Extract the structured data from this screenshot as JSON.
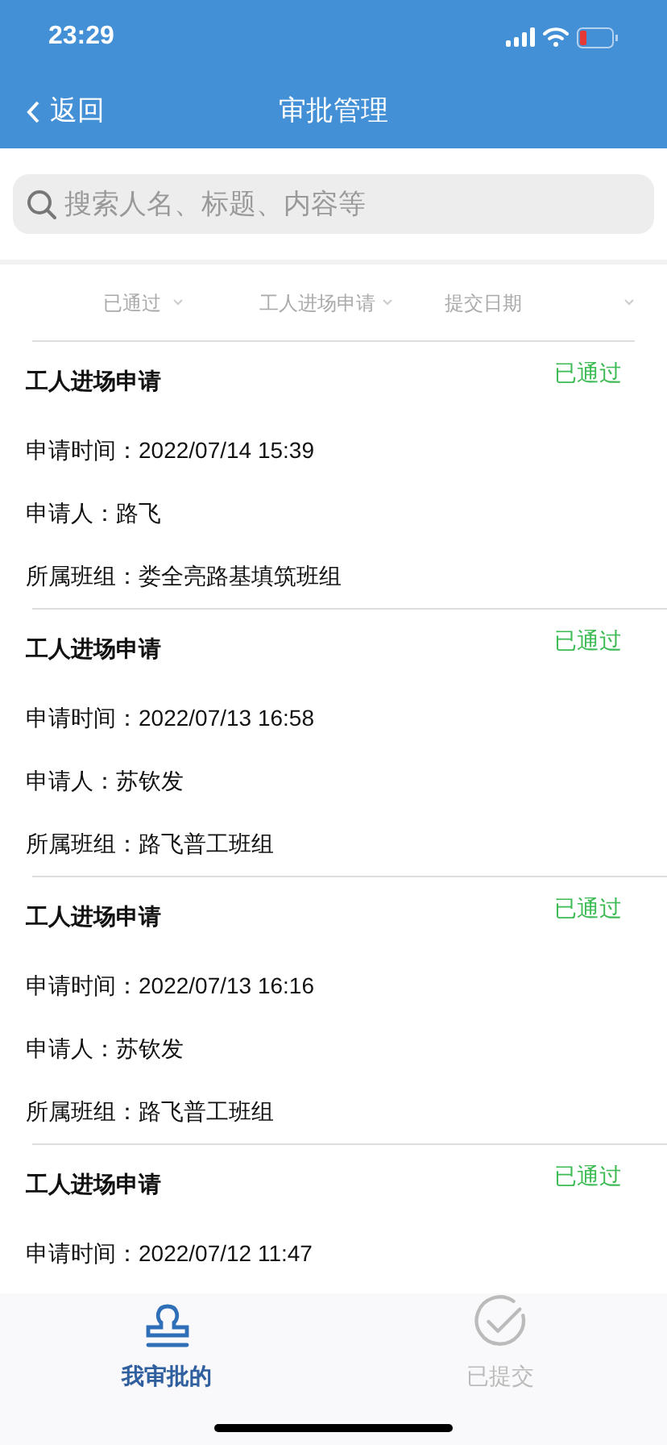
{
  "status_bar": {
    "time": "23:29"
  },
  "nav": {
    "back": "返回",
    "title": "审批管理"
  },
  "search": {
    "placeholder": "搜索人名、标题、内容等"
  },
  "filters": [
    {
      "label": "已通过"
    },
    {
      "label": "工人进场申请"
    },
    {
      "label": "提交日期"
    }
  ],
  "records": [
    {
      "title": "工人进场申请",
      "status": "已通过",
      "time_label": "申请时间：",
      "time": "2022/07/14 15:39",
      "applicant_label": "申请人：",
      "applicant": "路飞",
      "team_label": "所属班组：",
      "team": "娄全亮路基填筑班组"
    },
    {
      "title": "工人进场申请",
      "status": "已通过",
      "time_label": "申请时间：",
      "time": "2022/07/13 16:58",
      "applicant_label": "申请人：",
      "applicant": "苏钦发",
      "team_label": "所属班组：",
      "team": "路飞普工班组"
    },
    {
      "title": "工人进场申请",
      "status": "已通过",
      "time_label": "申请时间：",
      "time": "2022/07/13 16:16",
      "applicant_label": "申请人：",
      "applicant": "苏钦发",
      "team_label": "所属班组：",
      "team": "路飞普工班组"
    },
    {
      "title": "工人进场申请",
      "status": "已通过",
      "time_label": "申请时间：",
      "time": "2022/07/12 11:47"
    }
  ],
  "tabs": [
    {
      "label": "我审批的",
      "selected": true,
      "kind": "stamp"
    },
    {
      "label": "已提交",
      "selected": false,
      "kind": "check"
    }
  ]
}
